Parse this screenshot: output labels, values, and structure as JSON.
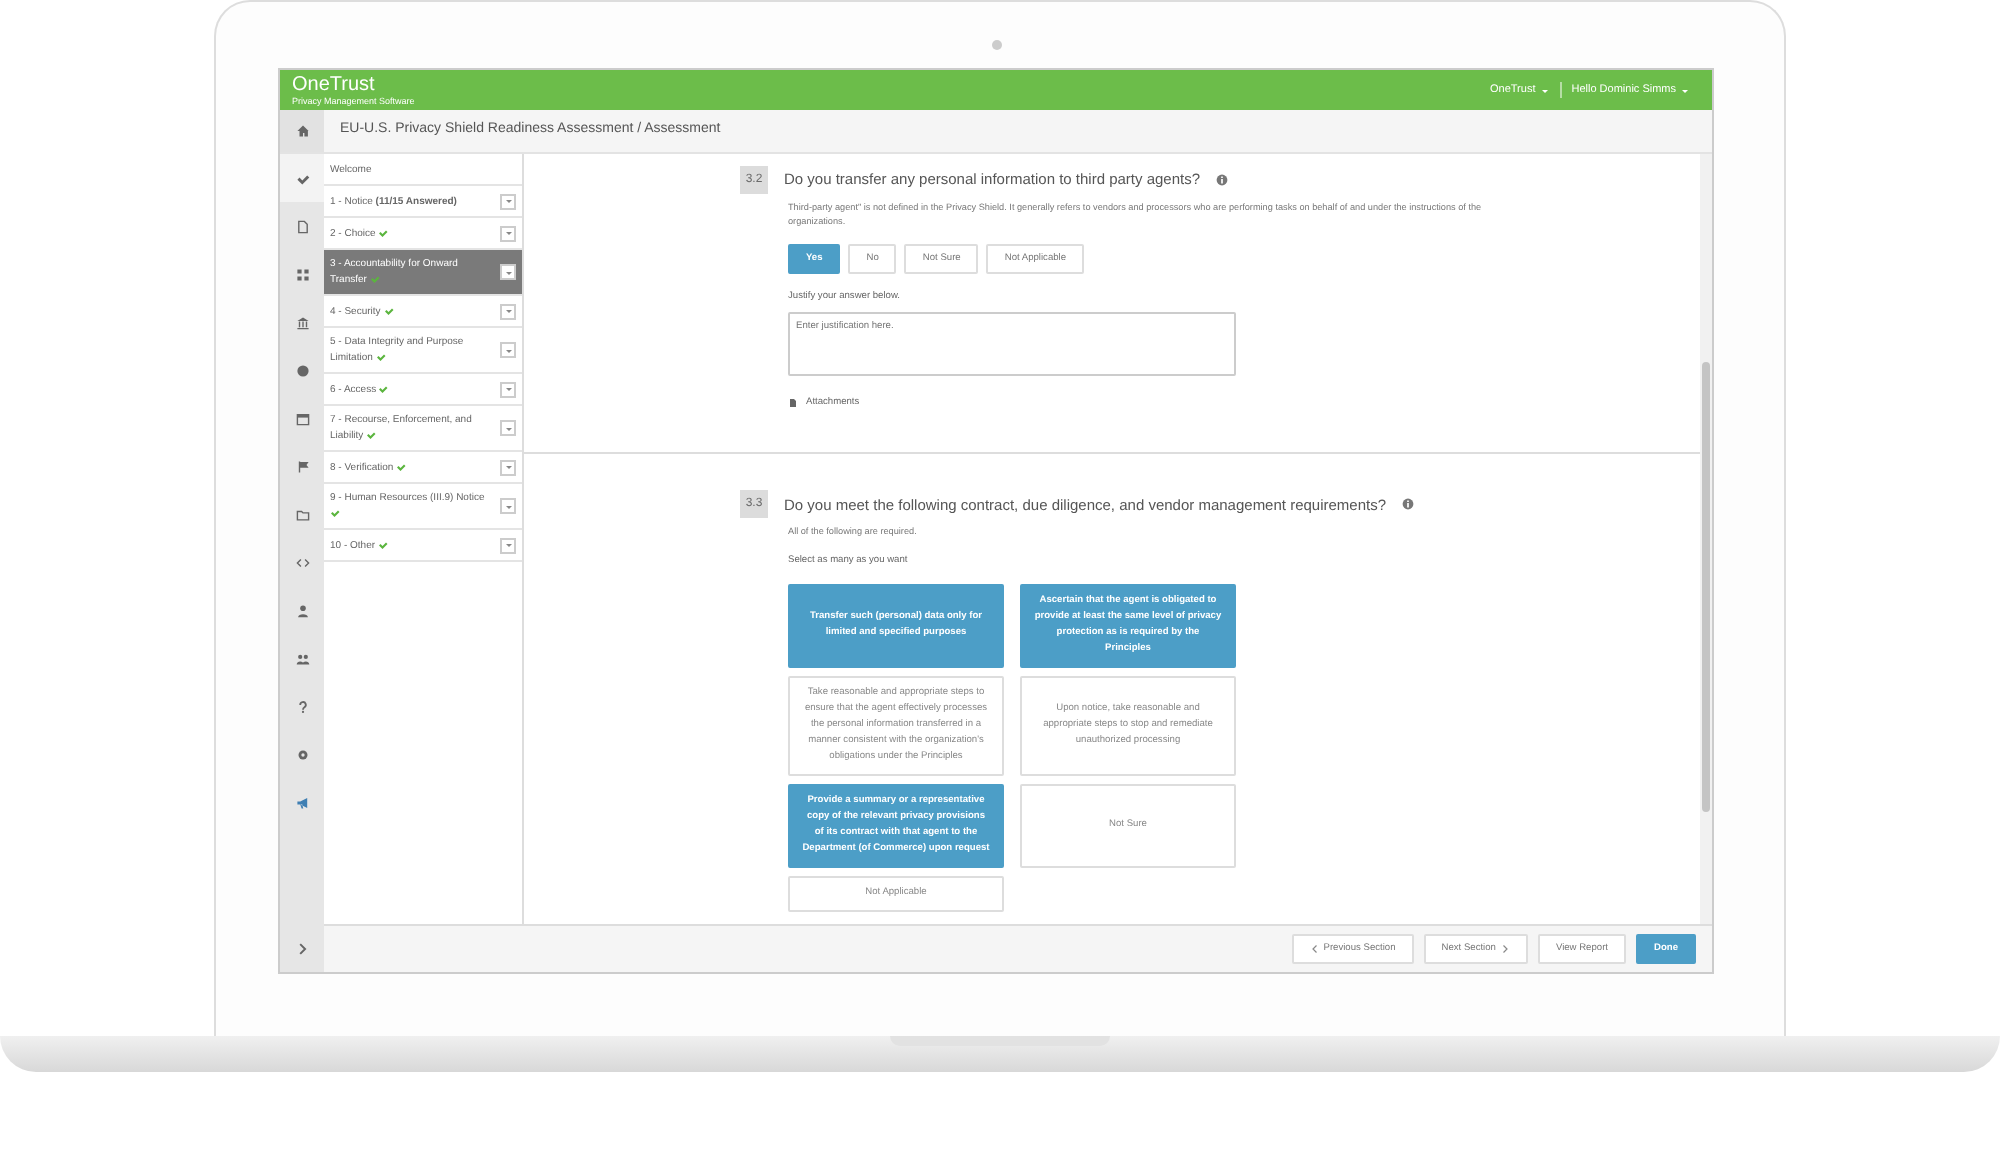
{
  "header": {
    "logo": "OneTrust",
    "tagline": "Privacy Management Software",
    "menus": [
      "OneTrust",
      "Hello Dominic Simms"
    ]
  },
  "breadcrumb": "EU-U.S. Privacy Shield Readiness Assessment / Assessment",
  "rail": [
    {
      "selected": true
    },
    {
      "selected": false
    },
    {
      "selected": false
    },
    {
      "selected": false
    },
    {
      "selected": false
    },
    {
      "selected": false
    },
    {
      "selected": false
    },
    {
      "selected": false
    },
    {
      "selected": false
    },
    {
      "selected": false
    },
    {
      "selected": false
    },
    {
      "selected": false
    },
    {
      "selected": false
    },
    {
      "selected": false
    }
  ],
  "sections": [
    {
      "kind": "welcome",
      "label": "Welcome",
      "complete": false,
      "selected": false
    },
    {
      "kind": "section",
      "label": "1 - Notice **(11/15 Answered)**",
      "complete": false,
      "selected": false
    },
    {
      "kind": "section",
      "label": "2 - Choice",
      "complete": true,
      "selected": false
    },
    {
      "kind": "section",
      "label": "3 - Accountability for Onward Transfer",
      "complete": true,
      "selected": true
    },
    {
      "kind": "section",
      "label": "4 - Security",
      "complete": true,
      "selected": false
    },
    {
      "kind": "section",
      "label": "5 - Data Integrity and Purpose Limitation",
      "complete": true,
      "selected": false
    },
    {
      "kind": "section",
      "label": "6 - Access",
      "complete": true,
      "selected": false
    },
    {
      "kind": "section",
      "label": "7 - Recourse, Enforcement, and Liability",
      "complete": true,
      "selected": false
    },
    {
      "kind": "section",
      "label": "8 - Verification",
      "complete": true,
      "selected": false
    },
    {
      "kind": "section",
      "label": "9 - Human Resources (III.9) Notice",
      "complete": true,
      "selected": false
    },
    {
      "kind": "section",
      "label": "10 - Other",
      "complete": true,
      "selected": false
    }
  ],
  "questions": [
    {
      "kind": "single",
      "number": "3.2",
      "title": "Do you transfer any personal information to third party agents?",
      "help": "Third-party agent\" is not defined in the Privacy Shield. It generally refers to vendors and processors who are performing tasks on behalf of and under the instructions of the organizations.",
      "answers": [
        {
          "label": "Yes",
          "selected": true
        },
        {
          "label": "No",
          "selected": false
        },
        {
          "label": "Not Sure",
          "selected": false
        },
        {
          "label": "Not Applicable",
          "selected": false
        }
      ],
      "justify_label": "Justify your answer below.",
      "placeholder": "Enter justification here.",
      "attachments": "Attachments"
    },
    {
      "kind": "multi",
      "number": "3.3",
      "title": "Do you meet the following contract, due diligence, and vendor management requirements?",
      "help": "All of the following are required.",
      "instruction": "Select as many as you want",
      "answers": [
        {
          "label": "Transfer such (personal) data only for limited and specified purposes",
          "selected": true
        },
        {
          "label": "Ascertain that the agent is obligated to provide at least the same level of privacy protection as is required by the Principles",
          "selected": true
        },
        {
          "label": "Take reasonable and appropriate steps to ensure that the agent effectively processes the personal information transferred in a manner consistent with the organization's obligations under the Principles",
          "selected": false
        },
        {
          "label": "Upon notice, take reasonable and appropriate steps to stop and remediate unauthorized processing",
          "selected": false
        },
        {
          "label": "Provide a summary or a representative copy of the relevant privacy provisions of its contract with that agent to the Department (of Commerce) upon request",
          "selected": true
        },
        {
          "label": "Not Sure",
          "selected": false
        },
        {
          "label": "Not Applicable",
          "selected": false
        }
      ]
    }
  ],
  "footer": [
    {
      "kind": "prev",
      "label": "Previous Section"
    },
    {
      "kind": "next",
      "label": "Next Section"
    },
    {
      "kind": "plain",
      "label": "View Report"
    },
    {
      "kind": "primary",
      "label": "Done"
    }
  ]
}
